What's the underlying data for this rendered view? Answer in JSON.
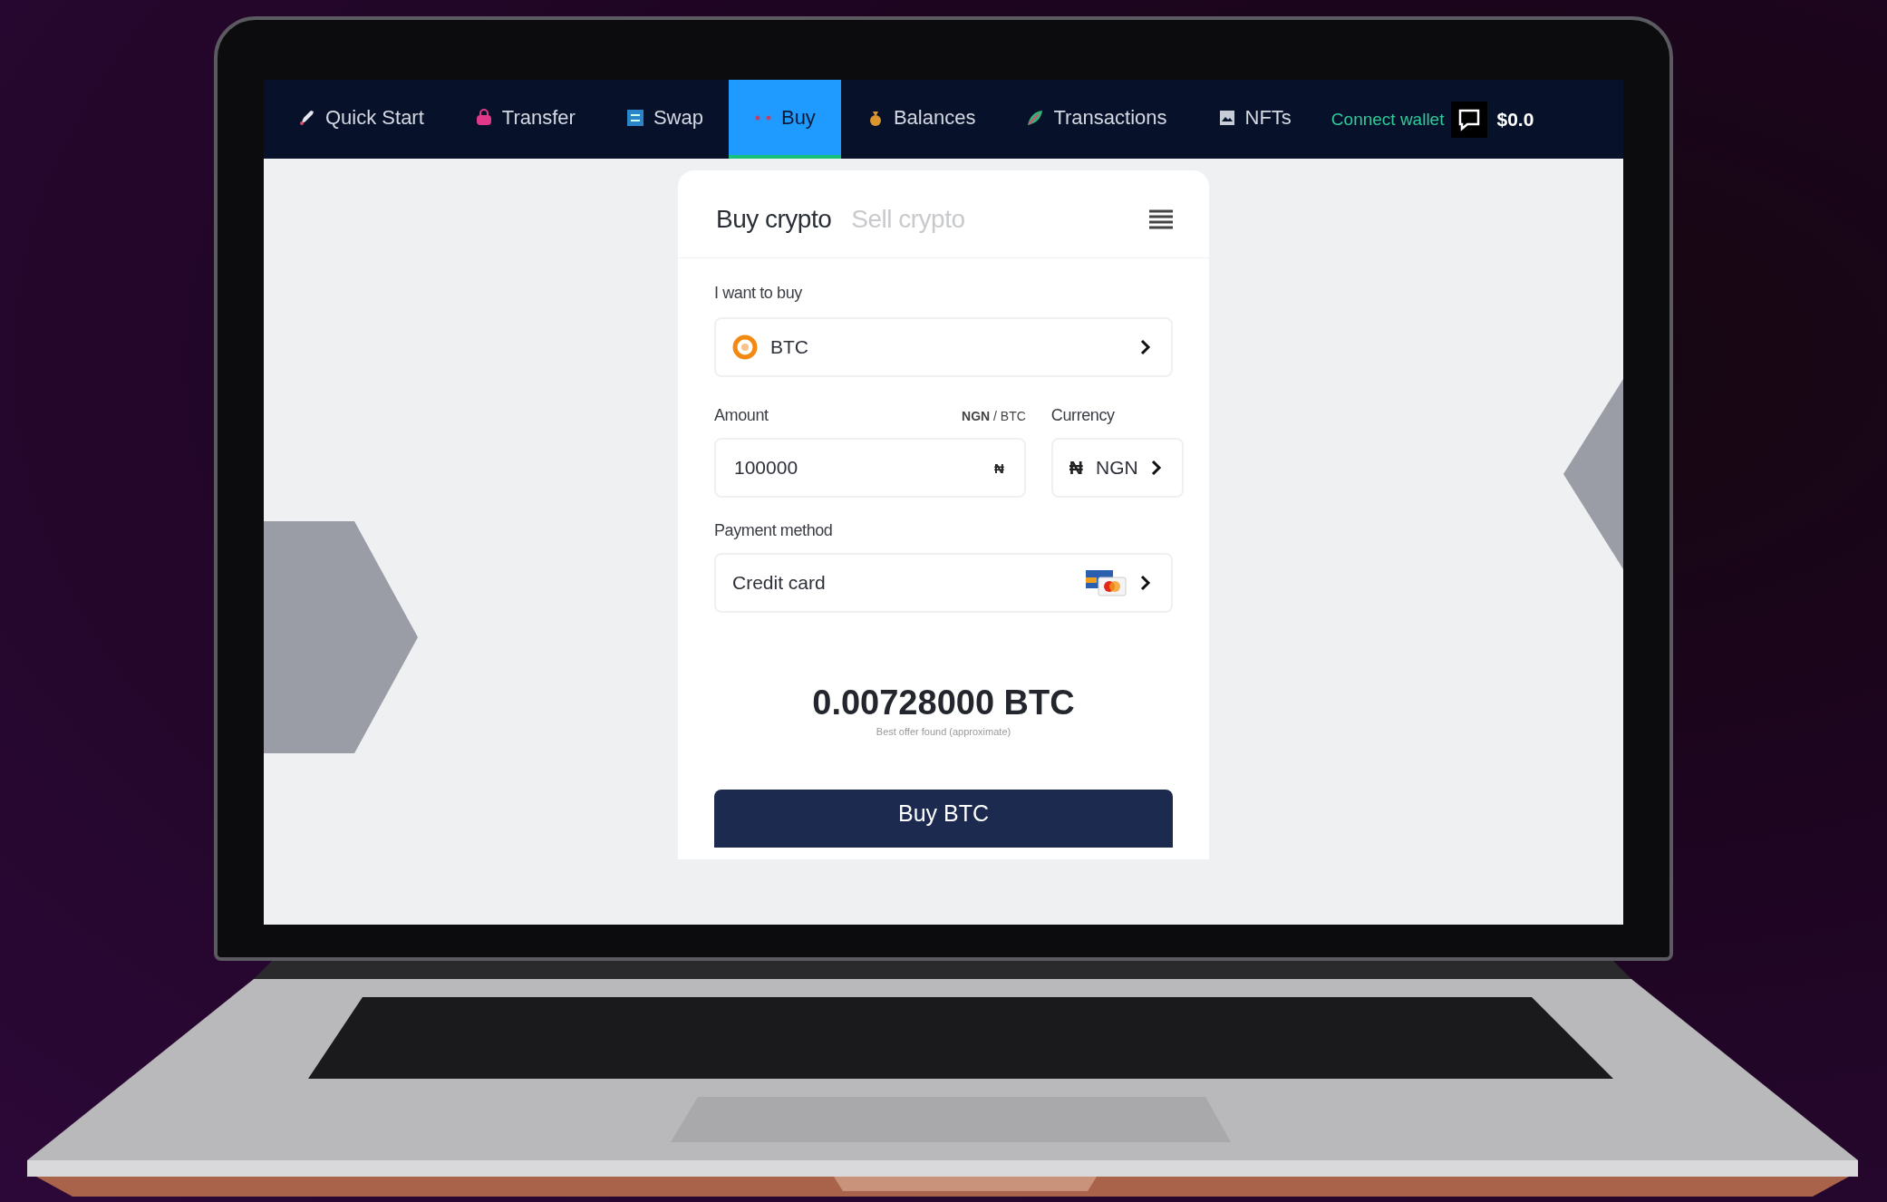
{
  "nav": {
    "items": [
      {
        "label": "Quick Start",
        "selected": false
      },
      {
        "label": "Transfer",
        "selected": false
      },
      {
        "label": "Swap",
        "selected": false
      },
      {
        "label": "Buy",
        "selected": true
      },
      {
        "label": "Balances",
        "selected": false
      },
      {
        "label": "Transactions",
        "selected": false
      },
      {
        "label": "NFTs",
        "selected": false
      }
    ],
    "connect_wallet": "Connect wallet",
    "balance": "$0.0"
  },
  "card": {
    "tabs": [
      {
        "label": "Buy crypto",
        "selected": true
      },
      {
        "label": "Sell crypto",
        "selected": false
      }
    ],
    "asset_label": "I want to buy",
    "asset": "BTC",
    "amount_label": "Amount",
    "unit_toggle": "**NGN** / BTC",
    "amount": "100000",
    "amount_symbol": "₦",
    "currency_label": "Currency",
    "currency_symbol": "₦",
    "currency": "NGN",
    "payment_label": "Payment method",
    "payment": "Credit card",
    "result": "0.00728000 BTC",
    "result_note": "Best offer found (approximate)",
    "button": "Buy BTC"
  }
}
